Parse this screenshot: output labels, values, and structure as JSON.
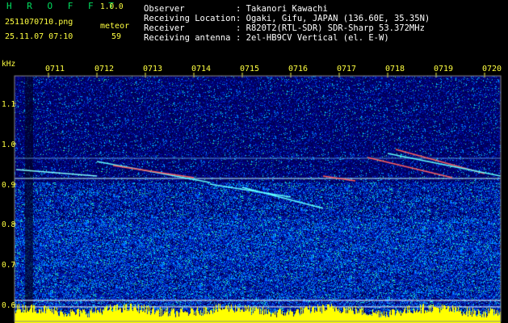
{
  "app": {
    "name": "H R O F F T",
    "version": "1.0.0"
  },
  "file": {
    "name": "2511070710.png",
    "datetime": "25.11.07 07:10"
  },
  "meteor": {
    "label": "meteor",
    "count": "59"
  },
  "info": [
    {
      "label": "Observer",
      "value": ": Takanori Kawachi"
    },
    {
      "label": "Receiving Location",
      "value": ": Ogaki, Gifu, JAPAN (136.60E, 35.35N)"
    },
    {
      "label": "Receiver",
      "value": ": R820T2(RTL-SDR) SDR-Sharp 53.372MHz"
    },
    {
      "label": "Receiving antenna",
      "value": ": 2el-HB9CV Vertical (el. E-W)"
    }
  ],
  "plot": {
    "freq_unit": "kHz",
    "freq_ticks": [
      "1.1",
      "1.0",
      "0.9",
      "0.8",
      "0.7",
      "0.6"
    ],
    "time_ticks": [
      "0711",
      "0712",
      "0713",
      "0714",
      "0715",
      "0716",
      "0717",
      "0718",
      "0719",
      "0720"
    ],
    "colors": {
      "background": "#000080",
      "noise": "#0040ff",
      "signal": "#00ffff",
      "hot": "#ff4040",
      "floor": "#ffff00",
      "label": "#ffff40"
    }
  }
}
